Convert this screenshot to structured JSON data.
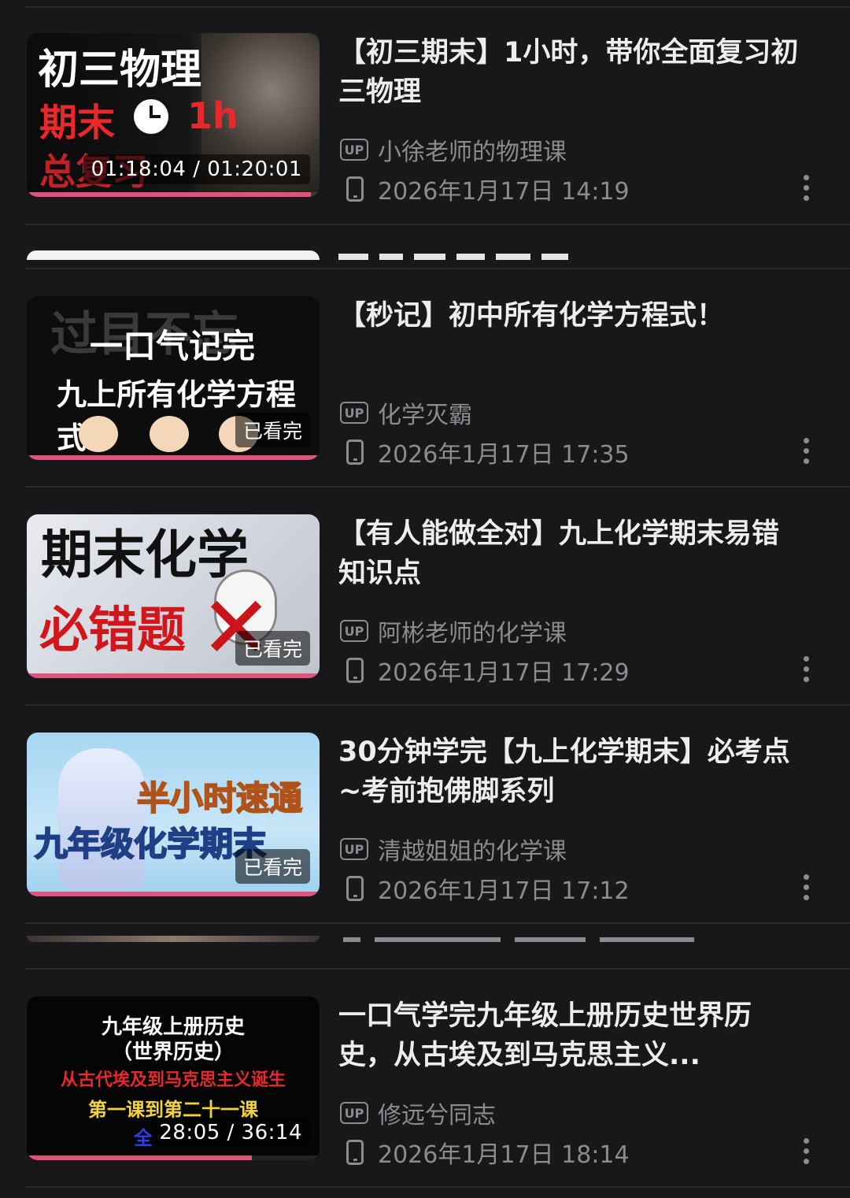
{
  "items": [
    {
      "title": "【初三期末】1小时，带你全面复习初三物理",
      "author": "小徐老师的物理课",
      "date": "2026年1月17日 14:19",
      "thumb_lines": [
        "初三物理",
        "期末",
        "1h",
        "总复习"
      ],
      "timecode": "01:18:04 / 01:20:01",
      "progress": 0.97
    },
    {
      "title": "【秒记】初中所有化学方程式！",
      "author": "化学灭霸",
      "date": "2026年1月17日 17:35",
      "thumb_lines": [
        "过目不忘",
        "一口气记完",
        "九上所有化学方程式"
      ],
      "badge": "已看完",
      "progress": 1.0
    },
    {
      "title": "【有人能做全对】九上化学期末易错知识点",
      "author": "阿彬老师的化学课",
      "date": "2026年1月17日 17:29",
      "thumb_lines": [
        "期末化学",
        "必错题"
      ],
      "badge": "已看完",
      "progress": 1.0
    },
    {
      "title": "30分钟学完【九上化学期末】必考点~考前抱佛脚系列",
      "author": "清越姐姐的化学课",
      "date": "2026年1月17日 17:12",
      "thumb_lines": [
        "半小时速通",
        "九年级化学期末"
      ],
      "badge": "已看完",
      "progress": 1.0
    },
    {
      "title": "一口气学完九年级上册历史世界历史，从古埃及到马克思主义...",
      "author": "修远兮同志",
      "date": "2026年1月17日 18:14",
      "thumb_lines": [
        "九年级上册历史",
        "（世界历史）",
        "从古代埃及到马克思主义诞生",
        "第一课到第二十一课",
        "全"
      ],
      "timecode": "28:05 / 36:14",
      "progress": 0.77
    }
  ],
  "up_label": "UP"
}
